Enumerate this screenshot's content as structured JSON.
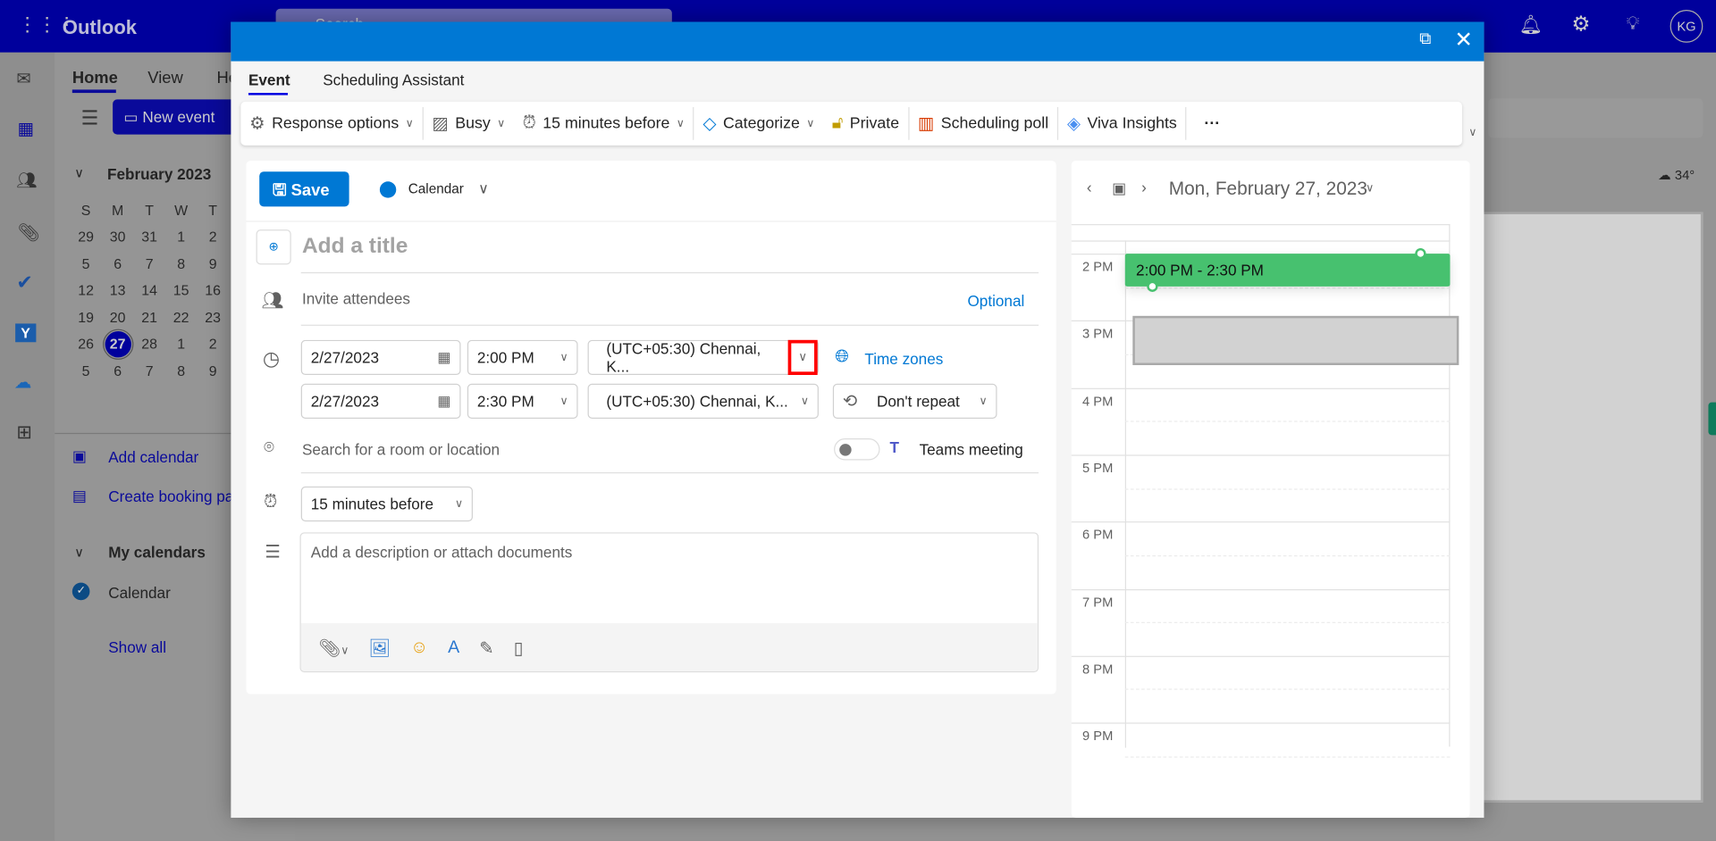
{
  "app": {
    "title": "Outlook",
    "search_placeholder": "Search",
    "avatar": "KG"
  },
  "ribbon_tabs": [
    {
      "label": "Home"
    },
    {
      "label": "View"
    },
    {
      "label": "He"
    }
  ],
  "new_event": "New event",
  "mini_calendar": {
    "title": "February 2023",
    "weekdays": [
      "S",
      "M",
      "T",
      "W",
      "T"
    ],
    "weeks": [
      [
        "29",
        "30",
        "31",
        "1",
        "2"
      ],
      [
        "5",
        "6",
        "7",
        "8",
        "9"
      ],
      [
        "12",
        "13",
        "14",
        "15",
        "16"
      ],
      [
        "19",
        "20",
        "21",
        "22",
        "23"
      ],
      [
        "26",
        "27",
        "28",
        "1",
        "2"
      ],
      [
        "5",
        "6",
        "7",
        "8",
        "9"
      ]
    ],
    "selected": "27"
  },
  "nav": {
    "add_calendar": "Add calendar",
    "create_booking": "Create booking pa",
    "my_calendars": "My calendars",
    "calendar": "Calendar",
    "show_all": "Show all"
  },
  "weather": "34°",
  "dialog": {
    "tabs": [
      {
        "label": "Event"
      },
      {
        "label": "Scheduling Assistant"
      }
    ],
    "toolbar": {
      "response": "Response options",
      "busy": "Busy",
      "reminder": "15 minutes before",
      "categorize": "Categorize",
      "private": "Private",
      "poll": "Scheduling poll",
      "viva": "Viva Insights",
      "more": "···"
    },
    "save": "Save",
    "calendar": "Calendar",
    "calendar_color": "#0078d4",
    "title_placeholder": "Add a title",
    "attendees_placeholder": "Invite attendees",
    "optional": "Optional",
    "start_date": "2/27/2023",
    "start_time": "2:00 PM",
    "start_tz": "(UTC+05:30) Chennai, K...",
    "end_date": "2/27/2023",
    "end_time": "2:30 PM",
    "end_tz": "(UTC+05:30) Chennai, K...",
    "time_zones": "Time zones",
    "repeat": "Don't repeat",
    "location_placeholder": "Search for a room or location",
    "teams": "Teams meeting",
    "teams_on": false,
    "reminder": "15 minutes before",
    "description_placeholder": "Add a description or attach documents"
  },
  "day_view": {
    "date": "Mon, February 27, 2023",
    "hours": [
      "2 PM",
      "3 PM",
      "4 PM",
      "5 PM",
      "6 PM",
      "7 PM",
      "8 PM",
      "9 PM"
    ],
    "event": "2:00 PM - 2:30 PM",
    "event_color": "#47c16f"
  }
}
